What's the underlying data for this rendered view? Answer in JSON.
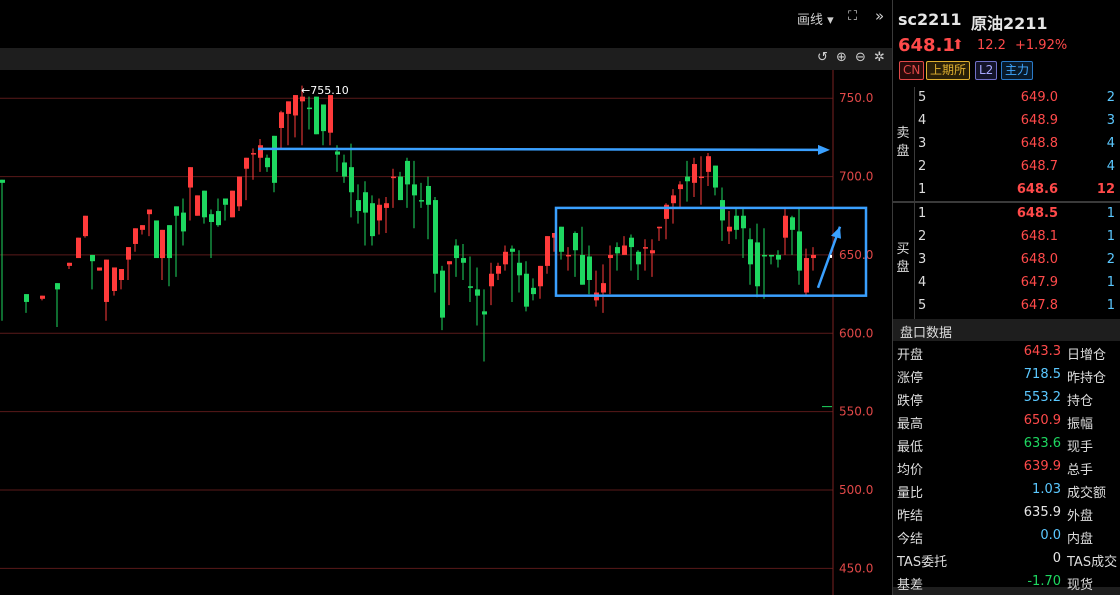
{
  "toolbar": {
    "draw_label": "画线 ▾"
  },
  "chart_data": {
    "type": "candlestick",
    "ylabels": [
      "750.0",
      "700.0",
      "650.0",
      "600.0",
      "550.0",
      "500.0",
      "450.0"
    ],
    "ylim": [
      433,
      768
    ],
    "high_annotation": "←755.10",
    "up_color": "#ff3b3b",
    "down_color": "#1ed760",
    "annotation_color": "#3aa0ff",
    "candles": [
      [
        0,
        663,
        698,
        696,
        608,
        "d"
      ],
      [
        24,
        620,
        625,
        620,
        613,
        "d"
      ],
      [
        40,
        623,
        624,
        622,
        621,
        "u"
      ],
      [
        55,
        620,
        632,
        628,
        604,
        "d"
      ],
      [
        67,
        645,
        643,
        645,
        641,
        "u"
      ],
      [
        76,
        650,
        661,
        648,
        648,
        "u"
      ],
      [
        83,
        662,
        675,
        662,
        661,
        "u"
      ],
      [
        90,
        650,
        646,
        650,
        628,
        "d"
      ],
      [
        97,
        640,
        642,
        640,
        640,
        "u"
      ],
      [
        104,
        620,
        647,
        620,
        608,
        "u"
      ],
      [
        112,
        625,
        642,
        627,
        624,
        "u"
      ],
      [
        119,
        632,
        641,
        634,
        628,
        "u"
      ],
      [
        126,
        647,
        655,
        647,
        634,
        "u"
      ],
      [
        133,
        666,
        657,
        667,
        652,
        "u"
      ],
      [
        140,
        665,
        669,
        666,
        663,
        "u"
      ],
      [
        147,
        672,
        679,
        676,
        662,
        "u"
      ],
      [
        154,
        672,
        672,
        648,
        648,
        "d"
      ],
      [
        160,
        650,
        666,
        648,
        634,
        "u"
      ],
      [
        167,
        645,
        669,
        648,
        630,
        "d"
      ],
      [
        174,
        676,
        681,
        675,
        636,
        "d"
      ],
      [
        181,
        686,
        665,
        677,
        656,
        "d"
      ],
      [
        188,
        691,
        706,
        693,
        672,
        "u"
      ],
      [
        195,
        688,
        675,
        688,
        680,
        "u"
      ],
      [
        202,
        688,
        691,
        674,
        670,
        "d"
      ],
      [
        209,
        679,
        676,
        671,
        648,
        "d"
      ],
      [
        216,
        686,
        669,
        678,
        668,
        "d"
      ],
      [
        223,
        680,
        686,
        682,
        672,
        "d"
      ],
      [
        230,
        681,
        691,
        674,
        678,
        "u"
      ],
      [
        237,
        681,
        700,
        681,
        678,
        "u"
      ],
      [
        244,
        705,
        712,
        705,
        685,
        "u"
      ],
      [
        251,
        718,
        715,
        715,
        698,
        "u"
      ],
      [
        258,
        724,
        720,
        712,
        703,
        "u"
      ],
      [
        265,
        714,
        706,
        712,
        703,
        "d"
      ],
      [
        272,
        725,
        726,
        696,
        690,
        "d"
      ],
      [
        279,
        742,
        741,
        731,
        718,
        "u"
      ],
      [
        286,
        737,
        748,
        740,
        720,
        "u"
      ],
      [
        293,
        737,
        752,
        739,
        725,
        "u"
      ],
      [
        300,
        758,
        751,
        748,
        720,
        "u"
      ],
      [
        307,
        751,
        744,
        744,
        730,
        "d"
      ],
      [
        314,
        751,
        751,
        727,
        727,
        "d"
      ],
      [
        321,
        733,
        746,
        729,
        720,
        "d"
      ],
      [
        328,
        747,
        752,
        728,
        720,
        "u"
      ],
      [
        335,
        720,
        714,
        716,
        703,
        "d"
      ],
      [
        342,
        714,
        709,
        700,
        696,
        "d"
      ],
      [
        349,
        721,
        706,
        690,
        674,
        "d"
      ],
      [
        356,
        695,
        685,
        678,
        670,
        "d"
      ],
      [
        363,
        697,
        690,
        677,
        656,
        "d"
      ],
      [
        370,
        688,
        683,
        662,
        656,
        "d"
      ],
      [
        377,
        686,
        682,
        672,
        663,
        "u"
      ],
      [
        384,
        687,
        683,
        680,
        664,
        "u"
      ],
      [
        391,
        705,
        699,
        700,
        680,
        "u"
      ],
      [
        398,
        703,
        700,
        685,
        687,
        "d"
      ],
      [
        405,
        712,
        710,
        695,
        680,
        "d"
      ],
      [
        412,
        710,
        695,
        688,
        667,
        "d"
      ],
      [
        419,
        696,
        685,
        685,
        680,
        "d"
      ],
      [
        426,
        700,
        694,
        682,
        660,
        "d"
      ],
      [
        433,
        687,
        685,
        638,
        626,
        "d"
      ],
      [
        440,
        643,
        640,
        610,
        602,
        "d"
      ],
      [
        447,
        637,
        646,
        644,
        618,
        "u"
      ],
      [
        454,
        660,
        656,
        648,
        636,
        "d"
      ],
      [
        461,
        657,
        645,
        648,
        634,
        "d"
      ],
      [
        468,
        649,
        630,
        629,
        620,
        "d"
      ],
      [
        475,
        642,
        628,
        624,
        605,
        "d"
      ],
      [
        482,
        628,
        612,
        614,
        582,
        "d"
      ],
      [
        489,
        645,
        630,
        638,
        618,
        "u"
      ],
      [
        496,
        645,
        638,
        643,
        634,
        "u"
      ],
      [
        503,
        656,
        644,
        652,
        640,
        "u"
      ],
      [
        510,
        656,
        654,
        652,
        620,
        "d"
      ],
      [
        517,
        653,
        645,
        637,
        626,
        "d"
      ],
      [
        524,
        646,
        638,
        617,
        614,
        "d"
      ],
      [
        531,
        635,
        625,
        629,
        621,
        "d"
      ],
      [
        538,
        643,
        643,
        630,
        622,
        "u"
      ],
      [
        545,
        662,
        643,
        662,
        638,
        "u"
      ],
      [
        552,
        664,
        661,
        664,
        652,
        "u"
      ],
      [
        559,
        668,
        668,
        652,
        647,
        "d"
      ],
      [
        566,
        655,
        650,
        650,
        640,
        "u"
      ],
      [
        573,
        665,
        664,
        653,
        636,
        "d"
      ],
      [
        580,
        668,
        650,
        631,
        632,
        "d"
      ],
      [
        587,
        656,
        649,
        634,
        625,
        "d"
      ],
      [
        594,
        640,
        626,
        621,
        617,
        "u"
      ],
      [
        601,
        644,
        626,
        632,
        613,
        "u"
      ],
      [
        608,
        656,
        648,
        650,
        625,
        "u"
      ],
      [
        615,
        658,
        655,
        651,
        640,
        "d"
      ],
      [
        622,
        662,
        650,
        656,
        650,
        "u"
      ],
      [
        629,
        663,
        661,
        655,
        640,
        "d"
      ],
      [
        636,
        653,
        652,
        644,
        634,
        "d"
      ],
      [
        643,
        660,
        654,
        655,
        640,
        "u"
      ],
      [
        650,
        660,
        651,
        653,
        636,
        "u"
      ],
      [
        657,
        667,
        668,
        667,
        659,
        "u"
      ],
      [
        664,
        683,
        673,
        682,
        660,
        "u"
      ],
      [
        671,
        692,
        683,
        688,
        670,
        "u"
      ],
      [
        678,
        697,
        692,
        695,
        680,
        "u"
      ],
      [
        685,
        710,
        700,
        697,
        684,
        "d"
      ],
      [
        692,
        712,
        708,
        696,
        687,
        "u"
      ],
      [
        699,
        713,
        700,
        700,
        682,
        "u"
      ],
      [
        706,
        715,
        713,
        703,
        694,
        "u"
      ],
      [
        713,
        707,
        707,
        693,
        688,
        "d"
      ],
      [
        720,
        693,
        685,
        672,
        659,
        "d"
      ],
      [
        727,
        678,
        668,
        665,
        657,
        "u"
      ],
      [
        734,
        680,
        675,
        666,
        660,
        "d"
      ],
      [
        741,
        680,
        675,
        667,
        648,
        "d"
      ],
      [
        748,
        667,
        660,
        644,
        631,
        "d"
      ],
      [
        755,
        670,
        658,
        630,
        623,
        "d"
      ],
      [
        762,
        667,
        650,
        650,
        622,
        "d"
      ],
      [
        769,
        650,
        650,
        649,
        644,
        "d"
      ],
      [
        776,
        653,
        650,
        647,
        642,
        "d"
      ],
      [
        783,
        680,
        675,
        661,
        650,
        "u"
      ],
      [
        790,
        675,
        674,
        666,
        650,
        "d"
      ],
      [
        797,
        680,
        665,
        640,
        631,
        "d"
      ],
      [
        804,
        654,
        648,
        626,
        624,
        "u"
      ],
      [
        811,
        655,
        650,
        648,
        640,
        "u"
      ]
    ],
    "hline": {
      "value": 717.7,
      "x1": 258,
      "x2": 830
    },
    "box": {
      "x1": 556,
      "x2": 866,
      "top": 680,
      "bottom": 624
    },
    "arrow": {
      "x1": 818,
      "y1": 629,
      "x2": 840,
      "y2": 668
    }
  },
  "quote": {
    "symbol": "sc2211",
    "name": "原油2211",
    "price": "648.1",
    "change": "12.2",
    "change_pct": "+1.92%",
    "badges": {
      "cn": "CN",
      "exchange": "上期所",
      "l2": "L2",
      "main": "主力"
    }
  },
  "order_book": {
    "sell_label": "卖\n盘",
    "buy_label": "买\n盘",
    "asks": [
      {
        "level": "5",
        "price": "649.0",
        "qty": "2"
      },
      {
        "level": "4",
        "price": "648.9",
        "qty": "3"
      },
      {
        "level": "3",
        "price": "648.8",
        "qty": "4"
      },
      {
        "level": "2",
        "price": "648.7",
        "qty": "4"
      },
      {
        "level": "1",
        "price": "648.6",
        "qty": "12"
      }
    ],
    "bids": [
      {
        "level": "1",
        "price": "648.5",
        "qty": "1"
      },
      {
        "level": "2",
        "price": "648.1",
        "qty": "1"
      },
      {
        "level": "3",
        "price": "648.0",
        "qty": "2"
      },
      {
        "level": "4",
        "price": "647.9",
        "qty": "1"
      },
      {
        "level": "5",
        "price": "647.8",
        "qty": "1"
      }
    ]
  },
  "stats": {
    "title": "盘口数据",
    "rows": [
      {
        "label": "开盘",
        "value": "643.3",
        "color": "#ff4a4a",
        "label2": "日增仓"
      },
      {
        "label": "涨停",
        "value": "718.5",
        "color": "#5bc8ff",
        "label2": "昨持仓"
      },
      {
        "label": "跌停",
        "value": "553.2",
        "color": "#5bc8ff",
        "label2": "持仓"
      },
      {
        "label": "最高",
        "value": "650.9",
        "color": "#ff4a4a",
        "label2": "振幅"
      },
      {
        "label": "最低",
        "value": "633.6",
        "color": "#1ed760",
        "label2": "现手"
      },
      {
        "label": "均价",
        "value": "639.9",
        "color": "#ff4a4a",
        "label2": "总手"
      },
      {
        "label": "量比",
        "value": "1.03",
        "color": "#5bc8ff",
        "label2": "成交额"
      },
      {
        "label": "昨结",
        "value": "635.9",
        "color": "#e6e6e6",
        "label2": "外盘"
      },
      {
        "label": "今结",
        "value": "0.0",
        "color": "#5bc8ff",
        "label2": "内盘"
      },
      {
        "label": "TAS委托",
        "value": "0",
        "color": "#e6e6e6",
        "label2": "TAS成交"
      },
      {
        "label": "基差",
        "value": "-1.70",
        "color": "#1ed760",
        "label2": "现货"
      }
    ]
  }
}
